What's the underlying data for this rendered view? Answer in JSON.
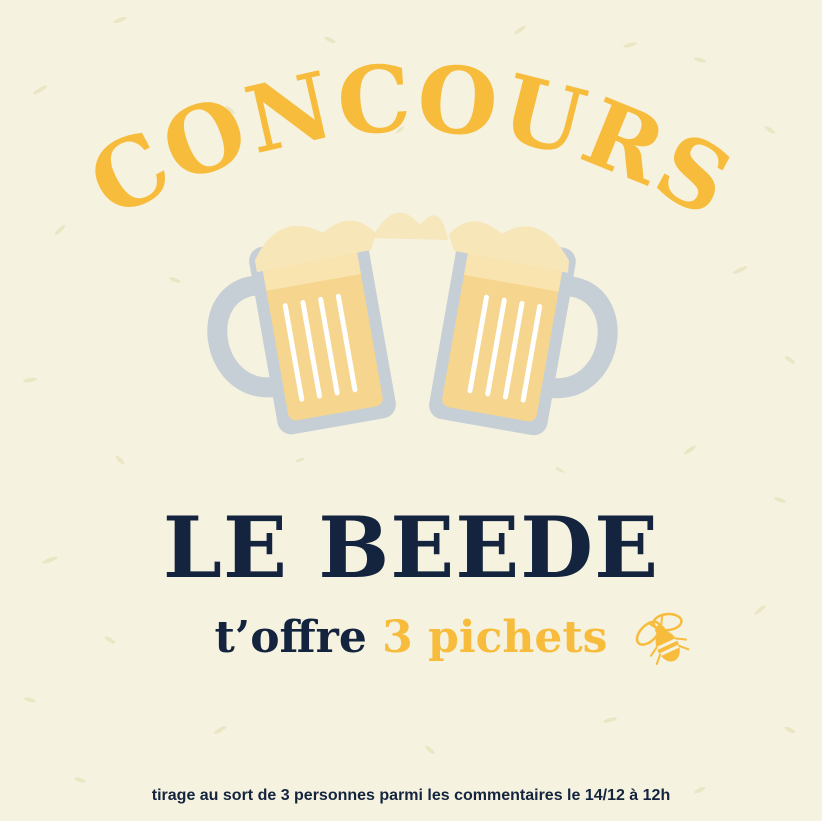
{
  "poster": {
    "headline": "CONCOURS",
    "brand": "LE BEEDE",
    "offer_prefix": "t’offre",
    "offer_highlight": "3 pichets",
    "footer": "tirage au sort de 3 personnes parmi les commentaires le 14/12 à 12h"
  },
  "colors": {
    "background": "#f5f2df",
    "accent": "#f7bc3c",
    "navy": "#14243f",
    "mug_glass": "#c6cfd6",
    "beer": "#f6d68e"
  },
  "icons": [
    "beer-mugs-illustration",
    "bee-icon"
  ]
}
